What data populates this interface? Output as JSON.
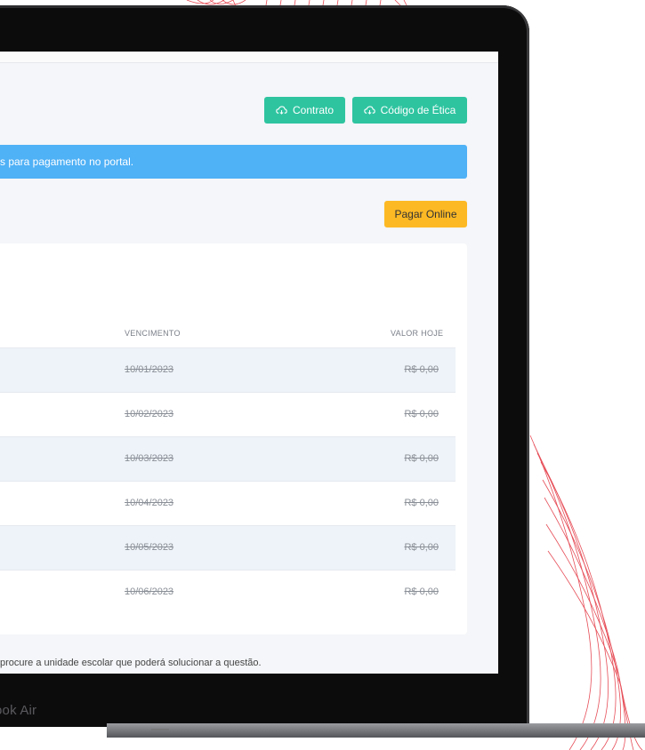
{
  "actions": {
    "contrato_label": "Contrato",
    "etica_label": "Código de Ética",
    "pagar_label": "Pagar Online"
  },
  "alert": {
    "text": "s para pagamento no portal."
  },
  "table": {
    "columns": [
      "VENCIMENTO",
      "VALOR HOJE"
    ],
    "rows": [
      {
        "vencimento": "10/01/2023",
        "valor": "R$ 0,00"
      },
      {
        "vencimento": "10/02/2023",
        "valor": "R$ 0,00"
      },
      {
        "vencimento": "10/03/2023",
        "valor": "R$ 0,00"
      },
      {
        "vencimento": "10/04/2023",
        "valor": "R$ 0,00"
      },
      {
        "vencimento": "10/05/2023",
        "valor": "R$ 0,00"
      },
      {
        "vencimento": "10/06/2023",
        "valor": "R$ 0,00"
      }
    ]
  },
  "footer": {
    "note": "procure a unidade escolar que poderá solucionar a questão."
  },
  "device": {
    "label": "ook Air"
  },
  "colors": {
    "accent_green": "#2ec4a0",
    "accent_yellow": "#fdb924",
    "alert_blue": "#4fb1f6",
    "decor_red": "#e2303c"
  },
  "icons": {
    "contrato": "cloud-download-icon",
    "etica": "cloud-download-icon"
  }
}
